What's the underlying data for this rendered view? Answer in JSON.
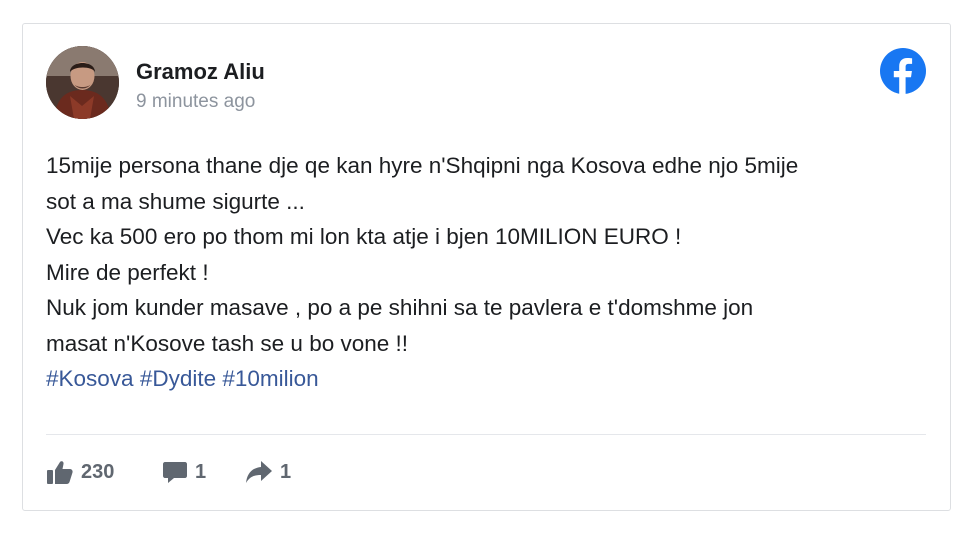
{
  "post": {
    "author_name": "Gramoz Aliu",
    "timestamp": "9 minutes ago",
    "body_lines": [
      "15mije persona thane dje qe kan hyre n'Shqipni nga Kosova edhe njo 5mije",
      "sot a ma shume sigurte ...",
      "Vec ka 500 ero po thom mi lon kta atje i bjen 10MILION EURO !",
      "Mire de perfekt !",
      "Nuk jom kunder masave , po a pe shihni sa te pavlera e t'domshme jon",
      "masat n'Kosove tash se u bo vone !!"
    ],
    "hashtags": [
      "#Kosova",
      "#Dydite",
      "#10milion"
    ]
  },
  "stats": {
    "likes": "230",
    "comments": "1",
    "shares": "1"
  },
  "icons": {
    "platform": "facebook-icon",
    "like": "thumbs-up-icon",
    "comment": "comment-icon",
    "share": "share-arrow-icon"
  },
  "colors": {
    "facebook_blue": "#1877f2",
    "hashtag": "#385898",
    "text": "#1c1e21",
    "muted": "#8d949e",
    "stat": "#606770"
  }
}
